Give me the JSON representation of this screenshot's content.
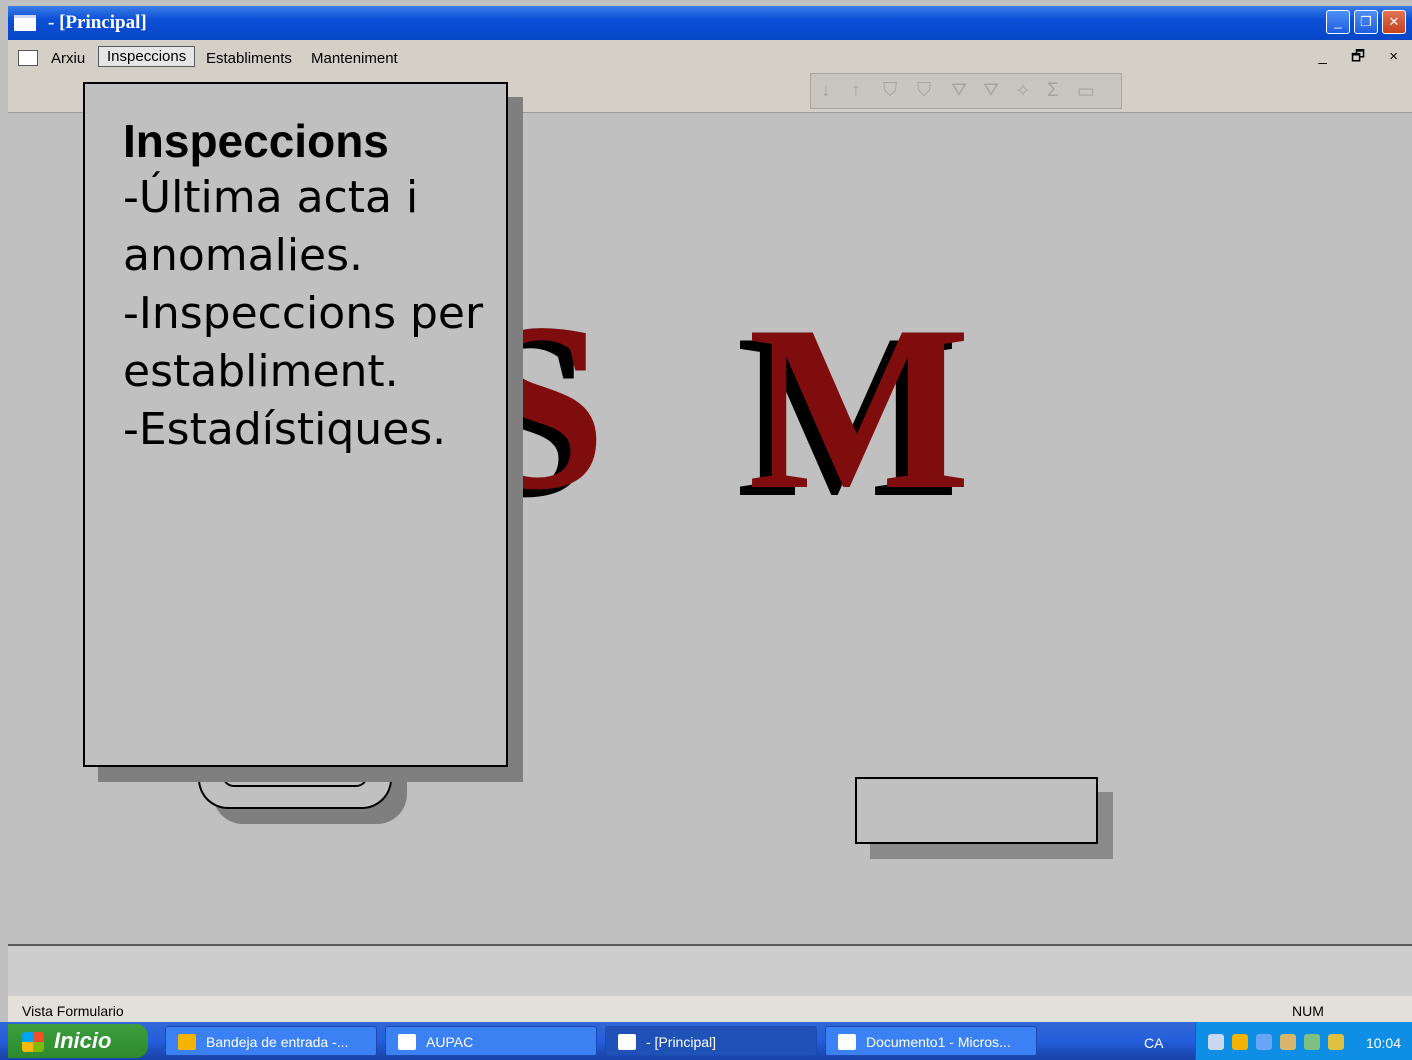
{
  "window": {
    "title": "- [Principal]"
  },
  "menu": {
    "items": [
      "Arxiu",
      "Inspeccions",
      "Establiments",
      "Manteniment"
    ],
    "mdi_controls": "_ 🗗 ×"
  },
  "toolbar": {
    "icons": [
      "sort-ascending-icon",
      "sort-descending-icon",
      "filter-by-selection-icon",
      "filter-by-form-icon",
      "apply-filter-icon",
      "remove-filter-icon",
      "find-icon",
      "new-record-icon",
      "delete-record-icon"
    ]
  },
  "logo": {
    "letters": [
      "S",
      "M"
    ]
  },
  "callout": {
    "title": "Inspeccions",
    "lines": [
      "-Última acta i",
      "anomalies.",
      "-Inspeccions per",
      "establiment.",
      "-Estadístiques."
    ]
  },
  "status": {
    "text": "Vista Formulario",
    "num": "NUM"
  },
  "taskbar": {
    "start": "Inicio",
    "items": [
      {
        "label": "Bandeja de entrada -...",
        "active": false
      },
      {
        "label": "AUPAC",
        "active": false
      },
      {
        "label": "- [Principal]",
        "active": true
      },
      {
        "label": "Documento1 - Micros...",
        "active": false
      }
    ],
    "lang": "CA",
    "clock": "10:04"
  },
  "colors": {
    "titlebar": "#0a4fd6",
    "logo_red": "#7f0d0d",
    "workspace": "#c0c0c0",
    "taskbar": "#245edb",
    "tray": "#0f8ee6"
  }
}
